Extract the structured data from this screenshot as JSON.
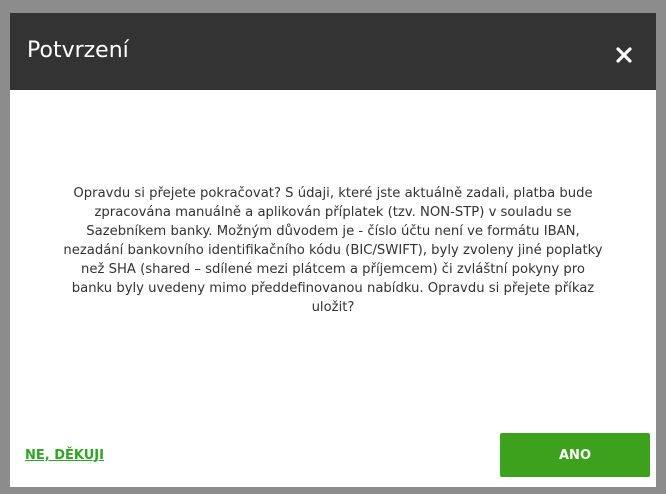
{
  "dialog": {
    "title": "Potvrzení",
    "close_icon": "close-icon",
    "message": "Opravdu si přejete pokračovat? S údaji, které jste aktuálně zadali, platba bude zpracována manuálně a aplikován příplatek (tzv. NON-STP) v souladu se Sazebníkem banky. Možným důvodem je - číslo účtu není ve formátu IBAN, nezadání bankovního identifikačního kódu (BIC/SWIFT), byly zvoleny jiné poplatky než SHA (shared – sdílené mezi plátcem a příjemcem) či zvláštní pokyny pro banku byly uvedeny mimo předdefinovanou nabídku. Opravdu si přejete příkaz uložit?",
    "decline_label": "NE, DĚKUJI",
    "confirm_label": "ANO"
  },
  "colors": {
    "overlay": "#8c8c8c",
    "header_bg": "#333333",
    "accent_green": "#3ca21d",
    "link_green": "#2ea623",
    "text": "#333333"
  }
}
